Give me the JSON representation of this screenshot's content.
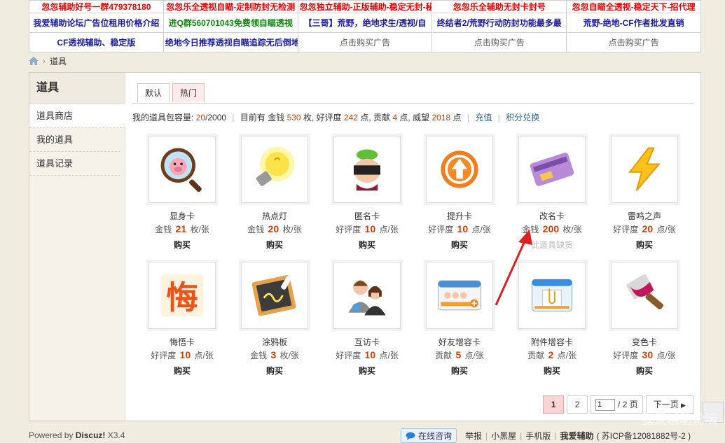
{
  "ads": {
    "row_partial": [
      "忽忽辅助好号一群479378180",
      "忽忽乐全透视自瞄-定制防封无检测",
      "忽忽独立辅助-正版辅助-稳定无封-秘籍",
      "忽忽乐全辅助无封卡封号",
      "忽忽自瞄全透视-稳定天下-招代理"
    ],
    "row1": [
      "我爱辅助论坛广告位租用价格介绍",
      "进Q群560701043免费领自瞄透视",
      "【三哥】荒野，绝地求生/透视/自",
      "终结者2/荒野行动防封功能最多最",
      "荒野-绝地-CF作者批发直销"
    ],
    "row2": [
      "CF透视辅助、稳定版",
      "绝地今日推荐透视自瞄追踪无后倒地",
      "点击购买广告",
      "点击购买广告",
      "点击购买广告"
    ]
  },
  "breadcrumb": {
    "current": "道具"
  },
  "sidebar": {
    "title": "道具",
    "items": [
      {
        "label": "道具商店"
      },
      {
        "label": "我的道具"
      },
      {
        "label": "道具记录"
      }
    ]
  },
  "tabs": [
    {
      "label": "默认"
    },
    {
      "label": "热门"
    }
  ],
  "stats": {
    "capacity_label": "我的道具包容量:",
    "capacity_used": "20",
    "capacity_total": "/2000",
    "have_label": "目前有 金钱",
    "money": "530",
    "unit_mei": "枚,",
    "rep_label": "好评度",
    "rep": "242",
    "unit_dian1": "点, 贡献",
    "contrib": "4",
    "unit_dian2": "点, 威望",
    "prestige": "2018",
    "unit_dian3": "点",
    "recharge": "充值",
    "exchange": "积分兑换"
  },
  "items": [
    {
      "name": "显身卡",
      "cur": "金钱",
      "price": "21",
      "unit": "枚/张",
      "action": "购买",
      "icon": "magnifier-pig-icon"
    },
    {
      "name": "热点灯",
      "cur": "金钱",
      "price": "20",
      "unit": "枚/张",
      "action": "购买",
      "icon": "lightbulb-icon"
    },
    {
      "name": "匿名卡",
      "cur": "好评度",
      "price": "10",
      "unit": "点/张",
      "action": "购买",
      "icon": "masked-face-icon"
    },
    {
      "name": "提升卡",
      "cur": "好评度",
      "price": "10",
      "unit": "点/张",
      "action": "购买",
      "icon": "up-arrow-icon"
    },
    {
      "name": "改名卡",
      "cur": "金钱",
      "price": "200",
      "unit": "枚/张",
      "action": "此道具缺货",
      "icon": "rename-card-icon"
    },
    {
      "name": "雷鸣之声",
      "cur": "好评度",
      "price": "20",
      "unit": "点/张",
      "action": "购买",
      "icon": "lightning-icon"
    },
    {
      "name": "悔悟卡",
      "cur": "好评度",
      "price": "10",
      "unit": "点/张",
      "action": "购买",
      "icon": "regret-char-icon"
    },
    {
      "name": "涂鸦板",
      "cur": "金钱",
      "price": "3",
      "unit": "枚/张",
      "action": "购买",
      "icon": "chalkboard-icon"
    },
    {
      "name": "互访卡",
      "cur": "好评度",
      "price": "10",
      "unit": "点/张",
      "action": "购买",
      "icon": "two-people-icon"
    },
    {
      "name": "好友增容卡",
      "cur": "贡献",
      "price": "5",
      "unit": "点/张",
      "action": "购买",
      "icon": "friends-card-icon"
    },
    {
      "name": "附件增容卡",
      "cur": "贡献",
      "price": "2",
      "unit": "点/张",
      "action": "购买",
      "icon": "paperclip-box-icon"
    },
    {
      "name": "变色卡",
      "cur": "好评度",
      "price": "30",
      "unit": "点/张",
      "action": "购买",
      "icon": "paint-brush-icon"
    }
  ],
  "pager": {
    "p1": "1",
    "p2": "2",
    "input": "1",
    "total": "/ 2 页",
    "next": "下一页"
  },
  "footer": {
    "powered": "Powered by",
    "brand": "Discuz!",
    "version": "X3.4",
    "consult": "在线咨询",
    "links": [
      "举报",
      "小黑屋",
      "手机版",
      "我爱辅助"
    ],
    "icp": "( 苏ICP备12081882号-2 )"
  },
  "watermark": "我爱辅助论坛"
}
